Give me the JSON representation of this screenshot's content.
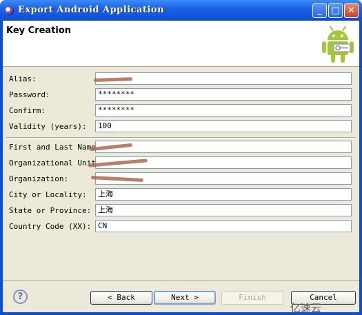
{
  "window": {
    "title": "Export Android Application"
  },
  "header": {
    "title": "Key Creation"
  },
  "form": {
    "alias": {
      "label": "Alias:",
      "value": ""
    },
    "password": {
      "label": "Password:",
      "value": "********"
    },
    "confirm": {
      "label": "Confirm:",
      "value": "********"
    },
    "validity": {
      "label": "Validity (years):",
      "value": "100"
    },
    "name": {
      "label": "First and Last Name:",
      "value": ""
    },
    "org_unit": {
      "label": "Organizational Unit:",
      "value": ""
    },
    "organization": {
      "label": "Organization:",
      "value": ""
    },
    "city": {
      "label": "City or Locality:",
      "value": "上海"
    },
    "state": {
      "label": "State or Province:",
      "value": "上海"
    },
    "country": {
      "label": "Country Code (XX):",
      "value": "CN"
    }
  },
  "buttons": {
    "back": "< Back",
    "next": "Next >",
    "finish": "Finish",
    "cancel": "Cancel"
  },
  "help_icon": "question-icon",
  "watermark": "亿速云",
  "colors": {
    "titlebar": "#0c4dd6",
    "android_green": "#a4c639"
  }
}
